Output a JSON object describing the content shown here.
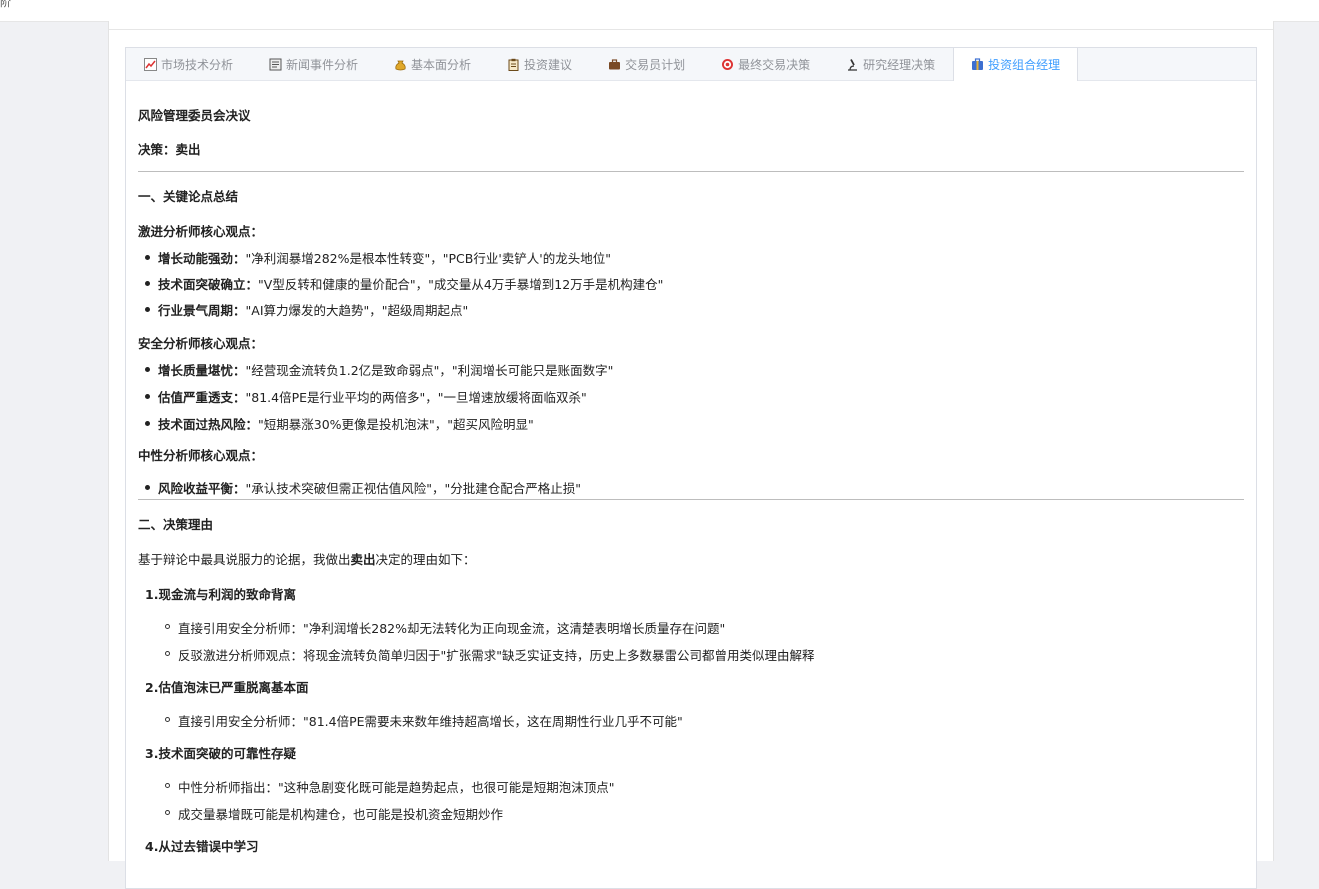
{
  "topbar": {
    "label": "阶"
  },
  "tabs": [
    {
      "icon": "chart-icon",
      "label": "市场技术分析",
      "active": false
    },
    {
      "icon": "newspaper-icon",
      "label": "新闻事件分析",
      "active": false
    },
    {
      "icon": "money-bag-icon",
      "label": "基本面分析",
      "active": false
    },
    {
      "icon": "clipboard-icon",
      "label": "投资建议",
      "active": false
    },
    {
      "icon": "briefcase-icon",
      "label": "交易员计划",
      "active": false
    },
    {
      "icon": "target-icon",
      "label": "最终交易决策",
      "active": false
    },
    {
      "icon": "microscope-icon",
      "label": "研究经理决策",
      "active": false
    },
    {
      "icon": "portfolio-icon",
      "label": "投资组合经理",
      "active": true
    }
  ],
  "report": {
    "title": "风险管理委员会决议",
    "decision": "决策：卖出",
    "sec1_title": "一、关键论点总结",
    "aggr_title": "激进分析师核心观点：",
    "aggr": [
      {
        "k": "增长动能强劲：",
        "v": "\"净利润暴增282%是根本性转变\"，\"PCB行业'卖铲人'的龙头地位\""
      },
      {
        "k": "技术面突破确立：",
        "v": "\"V型反转和健康的量价配合\"，\"成交量从4万手暴增到12万手是机构建仓\""
      },
      {
        "k": "行业景气周期：",
        "v": "\"AI算力爆发的大趋势\"，\"超级周期起点\""
      }
    ],
    "safe_title": "安全分析师核心观点：",
    "safe": [
      {
        "k": "增长质量堪忧：",
        "v": "\"经营现金流转负1.2亿是致命弱点\"，\"利润增长可能只是账面数字\""
      },
      {
        "k": "估值严重透支：",
        "v": "\"81.4倍PE是行业平均的两倍多\"，\"一旦增速放缓将面临双杀\""
      },
      {
        "k": "技术面过热风险：",
        "v": "\"短期暴涨30%更像是投机泡沫\"，\"超买风险明显\""
      }
    ],
    "neutral_title": "中性分析师核心观点：",
    "neutral": [
      {
        "k": "风险收益平衡：",
        "v": "\"承认技术突破但需正视估值风险\"，\"分批建仓配合严格止损\""
      }
    ],
    "sec2_title": "二、决策理由",
    "intro_pre": "基于辩论中最具说服力的论据，我做出",
    "intro_bold": "卖出",
    "intro_post": "决定的理由如下：",
    "reasons": [
      {
        "num": "1.",
        "title": "现金流与利润的致命背离",
        "items": [
          "直接引用安全分析师：\"净利润增长282%却无法转化为正向现金流，这清楚表明增长质量存在问题\"",
          "反驳激进分析师观点：将现金流转负简单归因于\"扩张需求\"缺乏实证支持，历史上多数暴雷公司都曾用类似理由解释"
        ]
      },
      {
        "num": "2.",
        "title": "估值泡沫已严重脱离基本面",
        "items": [
          "直接引用安全分析师：\"81.4倍PE需要未来数年维持超高增长，这在周期性行业几乎不可能\""
        ]
      },
      {
        "num": "3.",
        "title": "技术面突破的可靠性存疑",
        "items": [
          "中性分析师指出：\"这种急剧变化既可能是趋势起点，也很可能是短期泡沫顶点\"",
          "成交量暴增既可能是机构建仓，也可能是投机资金短期炒作"
        ]
      },
      {
        "num": "4.",
        "title": "从过去错误中学习",
        "items": []
      }
    ]
  }
}
